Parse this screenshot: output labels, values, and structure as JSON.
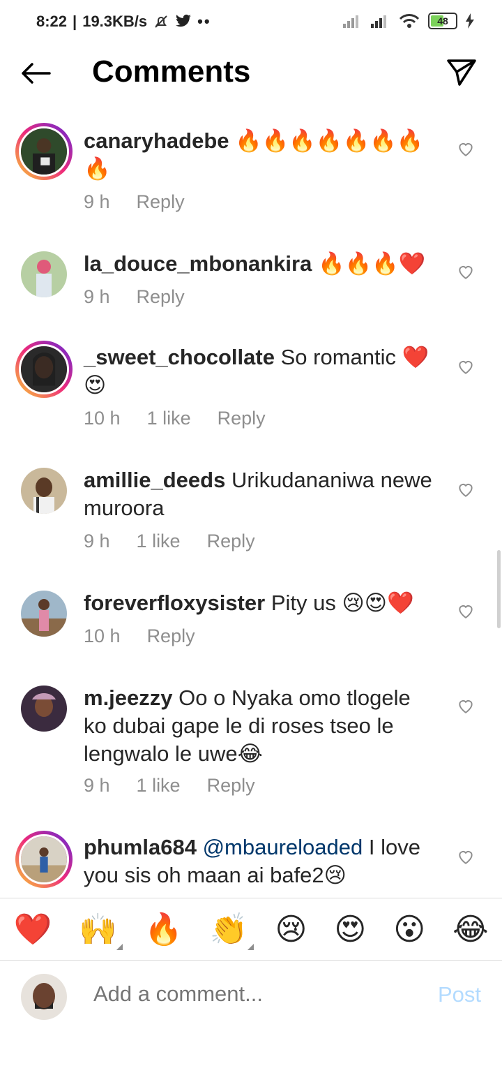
{
  "status": {
    "time": "8:22",
    "speed": "19.3KB/s",
    "battery": "48"
  },
  "header": {
    "title": "Comments"
  },
  "comments": [
    {
      "user": "canaryhadebe",
      "text": "🔥🔥🔥🔥🔥🔥🔥🔥",
      "time": "9 h",
      "likes": "",
      "reply": "Reply"
    },
    {
      "user": "la_douce_mbonankira",
      "text": "🔥🔥🔥❤️",
      "time": "9 h",
      "likes": "",
      "reply": "Reply"
    },
    {
      "user": "_sweet_chocollate",
      "text": "So romantic ❤️😍",
      "time": "10 h",
      "likes": "1 like",
      "reply": "Reply"
    },
    {
      "user": "amillie_deeds",
      "text": "Urikudananiwa newe muroora",
      "time": "9 h",
      "likes": "1 like",
      "reply": "Reply"
    },
    {
      "user": "foreverfloxysister",
      "text": "Pity us 😢😍❤️",
      "time": "10 h",
      "likes": "",
      "reply": "Reply"
    },
    {
      "user": "m.jeezzy",
      "text": "Oo o Nyaka omo tlogele ko dubai gape le di roses tseo le lengwalo le uwe😂",
      "time": "9 h",
      "likes": "1 like",
      "reply": "Reply"
    },
    {
      "user": "phumla684",
      "mention": "@mbaureloaded",
      "text": "I love you sis oh maan ai bafe2😢",
      "time": "",
      "likes": "",
      "reply": ""
    }
  ],
  "reactions": [
    "❤️",
    "🙌",
    "🔥",
    "👏",
    "😢",
    "😍",
    "😮",
    "😂"
  ],
  "composer": {
    "placeholder": "Add a comment...",
    "post_label": "Post"
  }
}
